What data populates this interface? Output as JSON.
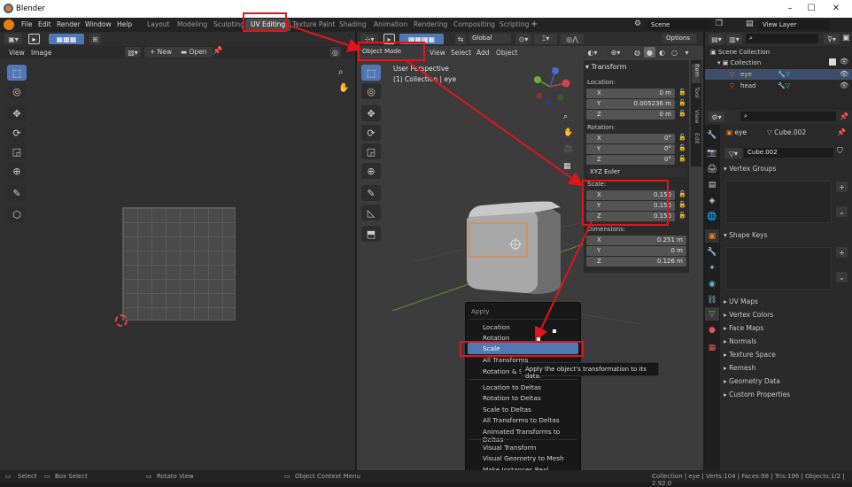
{
  "window": {
    "title": "Blender",
    "min": "–",
    "max": "☐",
    "close": "✕"
  },
  "menus": [
    "File",
    "Edit",
    "Render",
    "Window",
    "Help"
  ],
  "workspaces": [
    "Layout",
    "Modeling",
    "Sculpting",
    "UV Editing",
    "Texture Paint",
    "Shading",
    "Animation",
    "Rendering",
    "Compositing",
    "Scripting"
  ],
  "scene": {
    "name": "Scene",
    "view_layer": "View Layer"
  },
  "uv_editor": {
    "menu_view": "View",
    "menu_image": "Image",
    "new_label": "New",
    "open_label": "Open"
  },
  "viewport": {
    "mode": "Object Mode",
    "menu": [
      "View",
      "Select",
      "Add",
      "Object"
    ],
    "orientation": "Global",
    "options": "Options",
    "perspective": "User Perspective",
    "collection": "(1) Collection | eye",
    "gizmo_x": "X",
    "gizmo_y": "Y",
    "gizmo_z": "Z"
  },
  "transform": {
    "title": "Transform",
    "location_label": "Location:",
    "location": [
      {
        "axis": "X",
        "value": "0 m"
      },
      {
        "axis": "Y",
        "value": "0.005236 m"
      },
      {
        "axis": "Z",
        "value": "0 m"
      }
    ],
    "rotation_label": "Rotation:",
    "rotation": [
      {
        "axis": "X",
        "value": "0°"
      },
      {
        "axis": "Y",
        "value": "0°"
      },
      {
        "axis": "Z",
        "value": "0°"
      }
    ],
    "rotation_mode": "XYZ Euler",
    "scale_label": "Scale:",
    "scale": [
      {
        "axis": "X",
        "value": "0.150"
      },
      {
        "axis": "Y",
        "value": "0.150"
      },
      {
        "axis": "Z",
        "value": "0.150"
      }
    ],
    "dimensions_label": "Dimensions:",
    "dimensions": [
      {
        "axis": "X",
        "value": "0.251 m"
      },
      {
        "axis": "Y",
        "value": "0 m"
      },
      {
        "axis": "Z",
        "value": "0.126 m"
      }
    ]
  },
  "sidebar_tabs": [
    "Item",
    "Tool",
    "View",
    "Edit"
  ],
  "apply_menu": {
    "title": "Apply",
    "items": [
      "Location",
      "Rotation",
      "Scale",
      "All Transforms",
      "Rotation & S"
    ],
    "items2": [
      "Location to Deltas",
      "Rotation to Deltas",
      "Scale to Deltas",
      "All Transforms to Deltas",
      "Animated Transforms to Deltas"
    ],
    "items3": [
      "Visual Transform",
      "Visual Geometry to Mesh",
      "Make Instances Real"
    ],
    "tooltip": "Apply the object's transformation to its data."
  },
  "outliner": {
    "scene_collection": "Scene Collection",
    "collection": "Collection",
    "objects": [
      "eye",
      "head"
    ]
  },
  "properties": {
    "object_name": "eye",
    "mesh_name": "Cube.002",
    "mesh_field": "Cube.002",
    "sections": [
      "Vertex Groups",
      "Shape Keys",
      "UV Maps",
      "Vertex Colors",
      "Face Maps",
      "Normals",
      "Texture Space",
      "Remesh",
      "Geometry Data",
      "Custom Properties"
    ]
  },
  "statusbar": {
    "select": "Select",
    "box_select": "Box Select",
    "rotate_view": "Rotate View",
    "context_menu": "Object Context Menu",
    "info": "Collection | eye | Verts:104 | Faces:98 | Tris:196 | Objects:1/2 | 2.92.0"
  },
  "colors": {
    "accent": "#5078b4",
    "highlight_red": "#e0151a",
    "selection_orange": "#e8811a"
  }
}
